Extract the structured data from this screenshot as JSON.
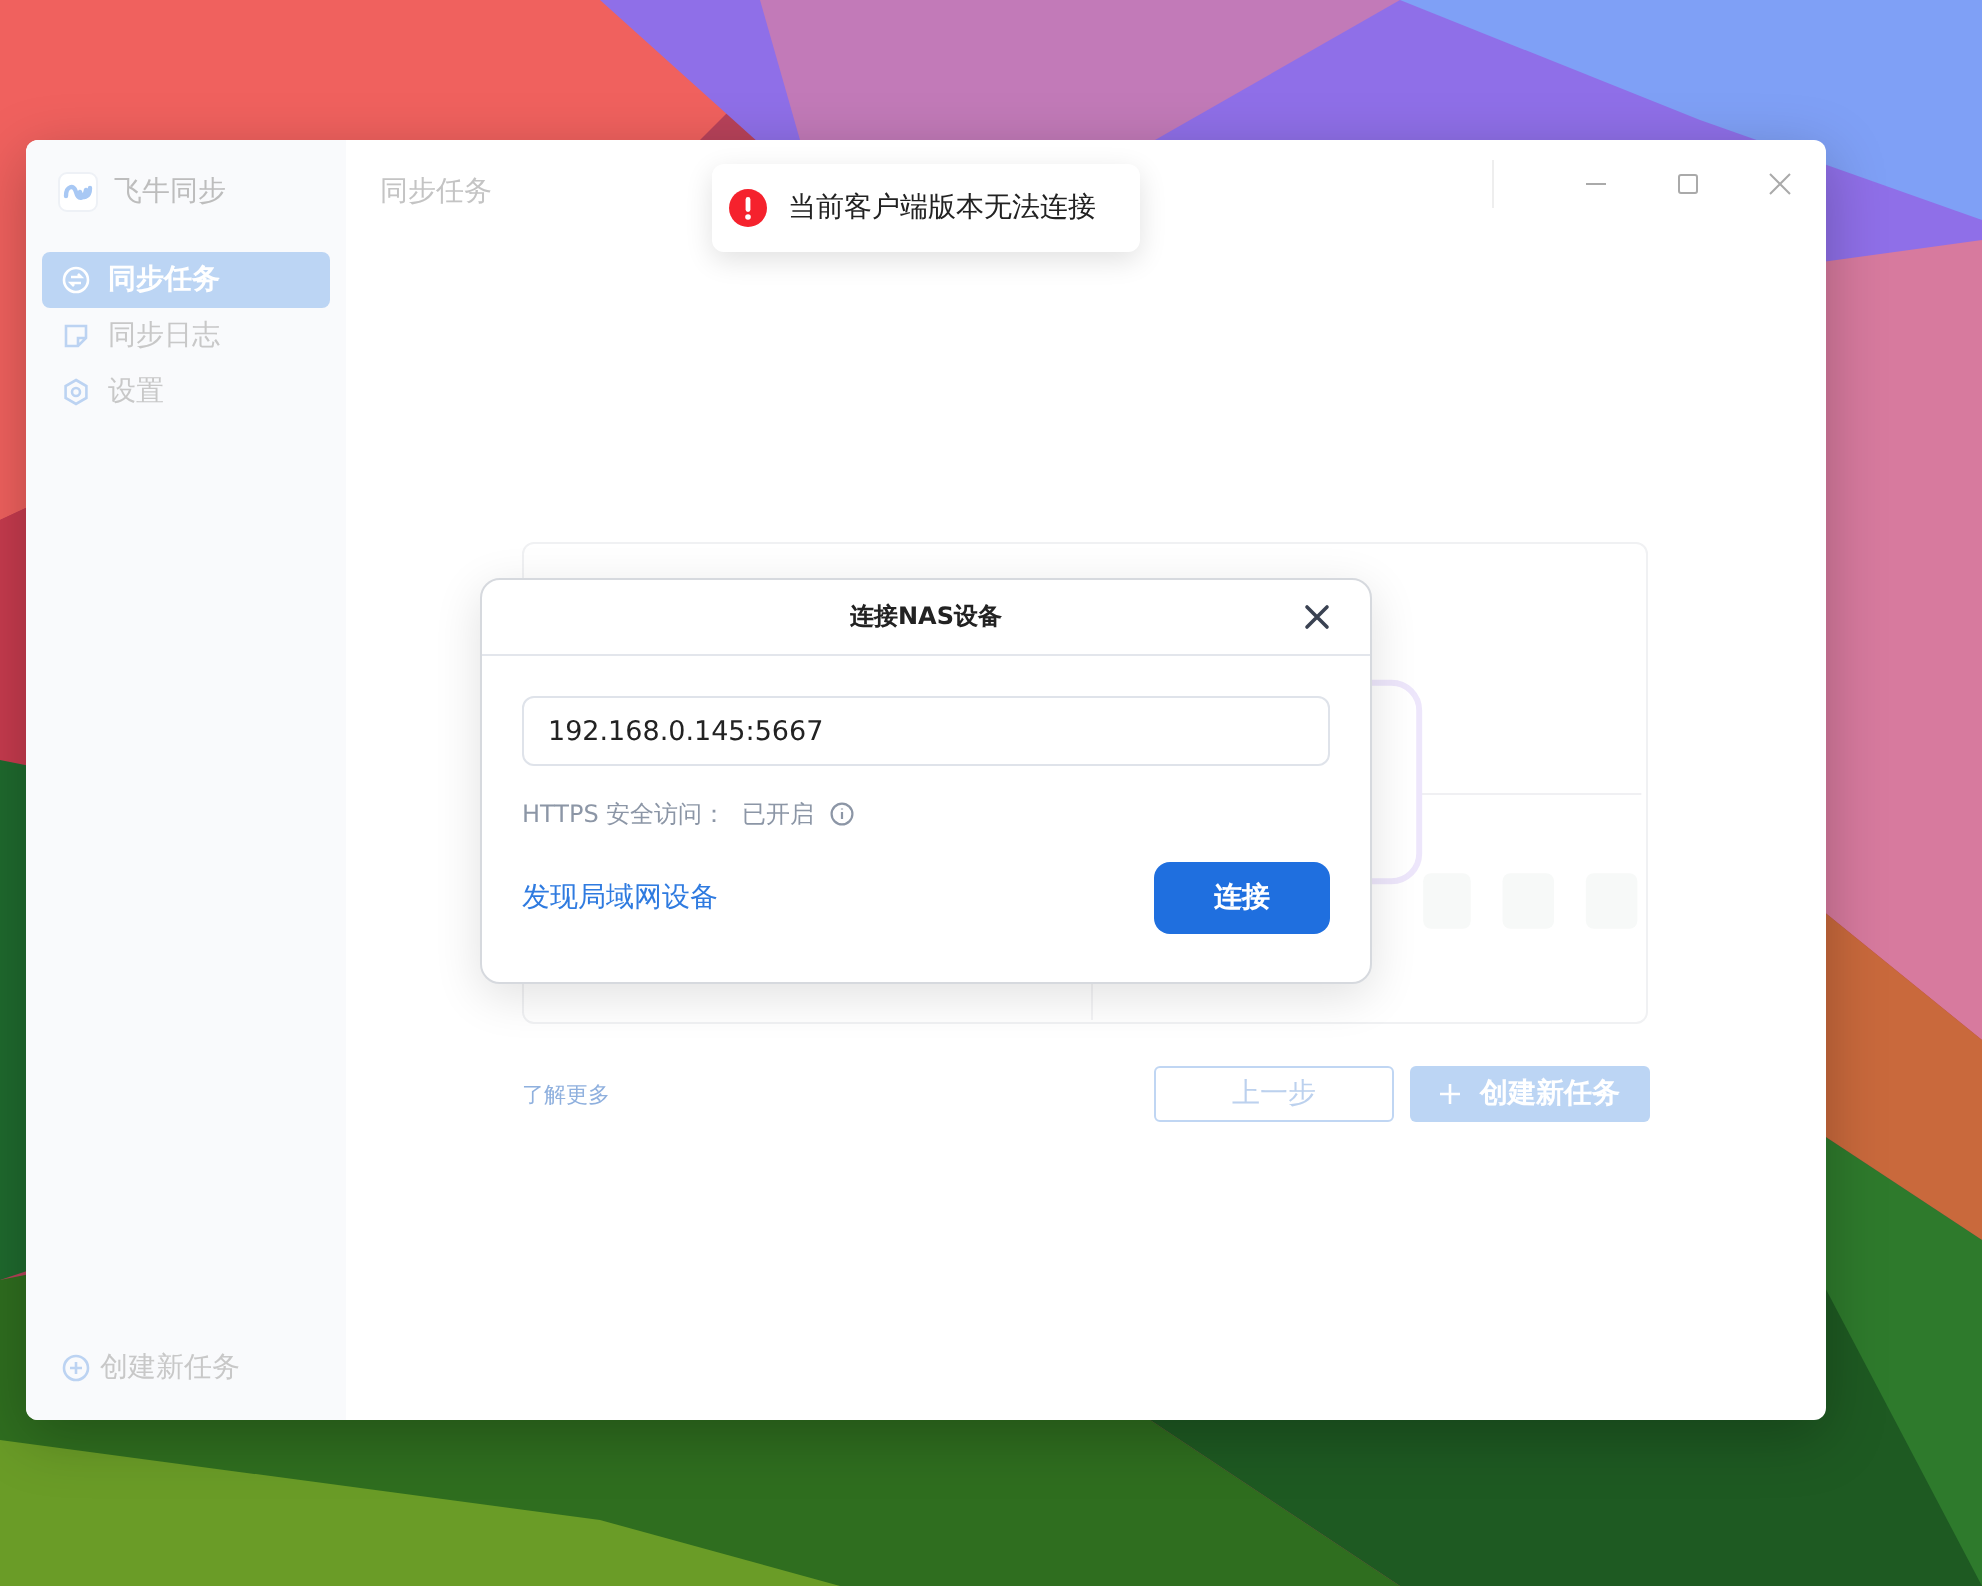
{
  "app": {
    "name": "飞牛同步"
  },
  "sidebar": {
    "items": [
      {
        "label": "同步任务",
        "selected": true
      },
      {
        "label": "同步日志",
        "selected": false
      },
      {
        "label": "设置",
        "selected": false
      }
    ],
    "footer_button": "创建新任务"
  },
  "page": {
    "title": "同步任务",
    "learn_more": "了解更多",
    "buttons": [
      {
        "label": "上一步",
        "kind": "outline"
      },
      {
        "label": "创建新任务",
        "kind": "primary"
      }
    ]
  },
  "toast": {
    "message": "当前客户端版本无法连接"
  },
  "dialog": {
    "title": "连接NAS设备",
    "address": "192.168.0.145:5667",
    "https_label": "HTTPS 安全访问：",
    "https_status": "已开启",
    "discover_link": "发现局域网设备",
    "connect_button": "连接"
  }
}
